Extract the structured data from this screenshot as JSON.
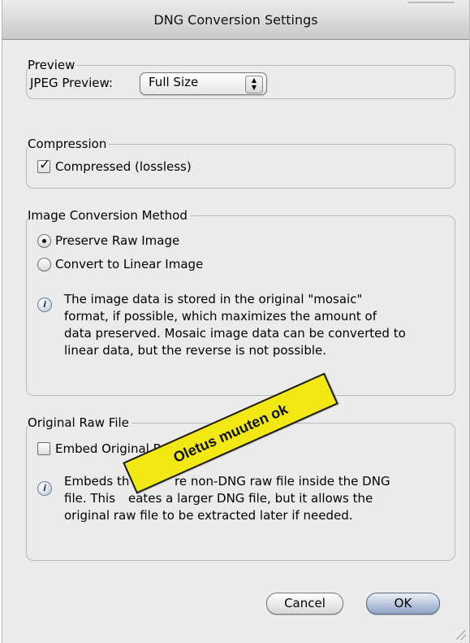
{
  "window": {
    "title": "DNG Conversion Settings"
  },
  "preview": {
    "group_label": "Preview",
    "jpeg_label": "JPEG Preview:",
    "jpeg_value": "Full Size"
  },
  "compression": {
    "group_label": "Compression",
    "checkbox_label": "Compressed (lossless)",
    "checked": true
  },
  "conversion": {
    "group_label": "Image Conversion Method",
    "options": [
      {
        "label": "Preserve Raw Image",
        "selected": true
      },
      {
        "label": "Convert to Linear Image",
        "selected": false
      }
    ],
    "info_lines": [
      "The image data is stored in the original \"mosaic\"",
      "format, if possible, which maximizes the amount of",
      "data preserved. Mosaic image data can be converted to",
      "linear data, but the reverse is not possible."
    ]
  },
  "original_raw": {
    "group_label": "Original Raw File",
    "checkbox_label": "Embed Original Ra",
    "checked": false,
    "info_lines": [
      "Embeds th",
      "re non-DNG raw file inside the DNG",
      "file. This",
      "eates a larger DNG file, but it allows the",
      "original raw file to be extracted later if needed."
    ]
  },
  "buttons": {
    "cancel": "Cancel",
    "ok": "OK"
  },
  "annotation": {
    "text": "Oletus muuten ok",
    "color": "#f2e814"
  }
}
